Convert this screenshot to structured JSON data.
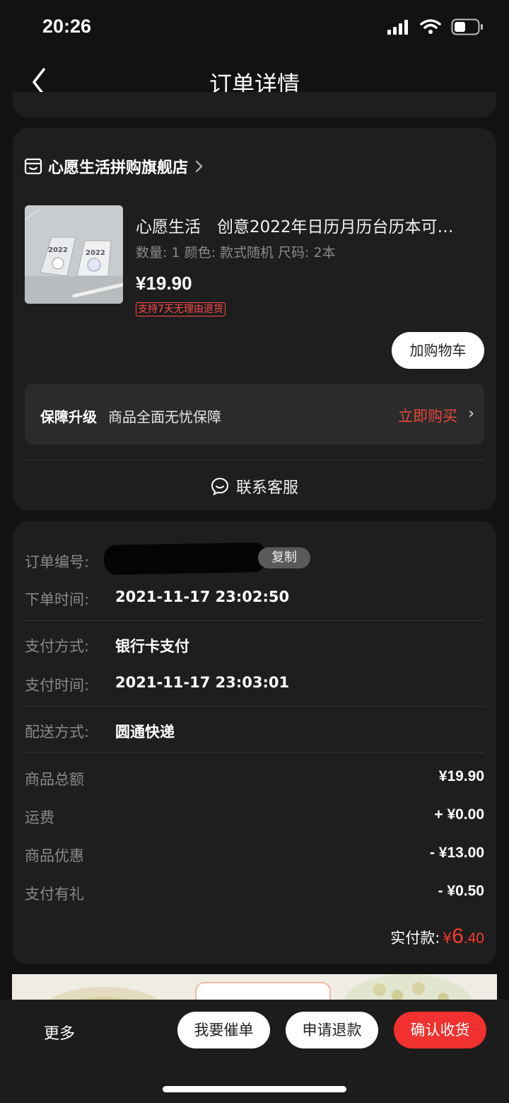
{
  "status": {
    "time": "20:26"
  },
  "nav": {
    "title": "订单详情"
  },
  "shop": {
    "name": "心愿生活拼购旗舰店"
  },
  "product": {
    "title": "心愿生活　创意2022年日历月历台历本可…",
    "spec": "数量: 1  颜色: 款式随机  尺码: 2本",
    "price": "¥19.90",
    "tag": "支持7天无理由退货",
    "thumb_text_1": "2022",
    "thumb_text_2": "2022",
    "add_cart": "加购物车"
  },
  "insurance": {
    "label": "保障升级",
    "desc": "商品全面无忧保障",
    "action": "立即购买"
  },
  "contact": {
    "label": "联系客服"
  },
  "order": {
    "number_label": "订单编号:",
    "copy_label": "复制",
    "time_label": "下单时间:",
    "time_value": "2021-11-17 23:02:50",
    "pay_method_label": "支付方式:",
    "pay_method_value": "银行卡支付",
    "pay_time_label": "支付时间:",
    "pay_time_value": "2021-11-17 23:03:01",
    "delivery_label": "配送方式:",
    "delivery_value": "圆通快递"
  },
  "amounts": [
    {
      "label": "商品总额",
      "value": "¥19.90"
    },
    {
      "label": "运费",
      "value": "+ ¥0.00"
    },
    {
      "label": "商品优惠",
      "value": "- ¥13.00"
    },
    {
      "label": "支付有礼",
      "value": "- ¥0.50"
    }
  ],
  "paid": {
    "label": "实付款:",
    "symbol": "¥",
    "integer": "6",
    "decimal": ".40"
  },
  "bottom": {
    "more": "更多",
    "urge": "我要催单",
    "refund": "申请退款",
    "confirm": "确认收货"
  },
  "colors": {
    "accent_red": "#f0312f",
    "background": "#121212",
    "card": "#1e1e1e"
  }
}
